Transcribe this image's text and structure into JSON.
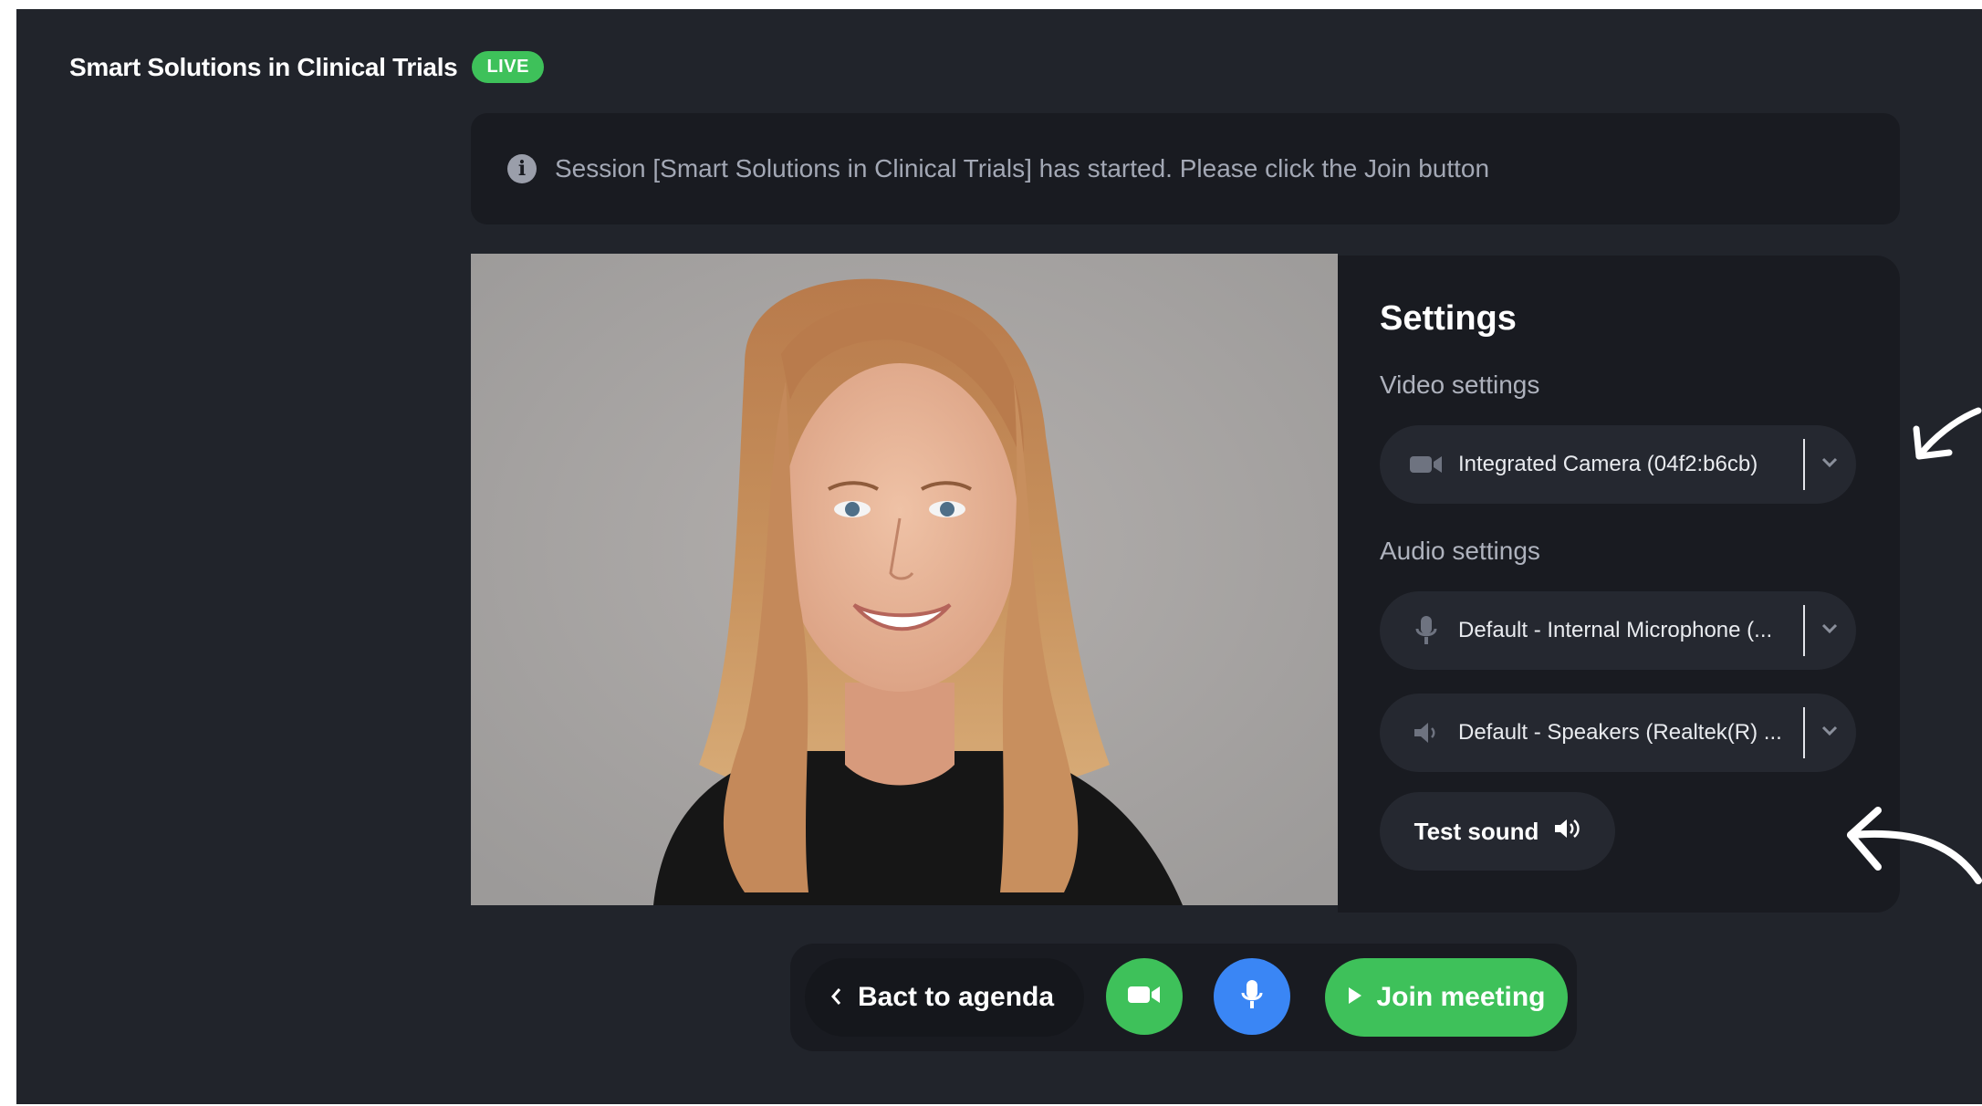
{
  "header": {
    "session_title": "Smart Solutions in Clinical Trials",
    "live_badge": "LIVE"
  },
  "notice": {
    "icon": "info-icon",
    "text": "Session [Smart Solutions in Clinical Trials] has started. Please click the Join button"
  },
  "video_preview": {
    "content": "camera preview of a smiling woman with long strawberry-blonde hair in a black top"
  },
  "settings": {
    "title": "Settings",
    "video_label": "Video settings",
    "camera": {
      "icon": "video-camera-icon",
      "value": "Integrated Camera (04f2:b6cb)"
    },
    "audio_label": "Audio settings",
    "microphone": {
      "icon": "microphone-icon",
      "value": "Default - Internal Microphone (..."
    },
    "speaker": {
      "icon": "speaker-icon",
      "value": "Default - Speakers (Realtek(R) ..."
    },
    "test_sound": {
      "label": "Test sound",
      "icon": "volume-icon"
    }
  },
  "toolbar": {
    "back_label": "Bact to agenda",
    "camera_button": "video-camera-icon",
    "mic_button": "microphone-icon",
    "join_label": "Join meeting"
  },
  "colors": {
    "background": "#21242b",
    "panel": "#191b21",
    "accent_green": "#3ec15a",
    "accent_blue": "#3a86f5"
  }
}
